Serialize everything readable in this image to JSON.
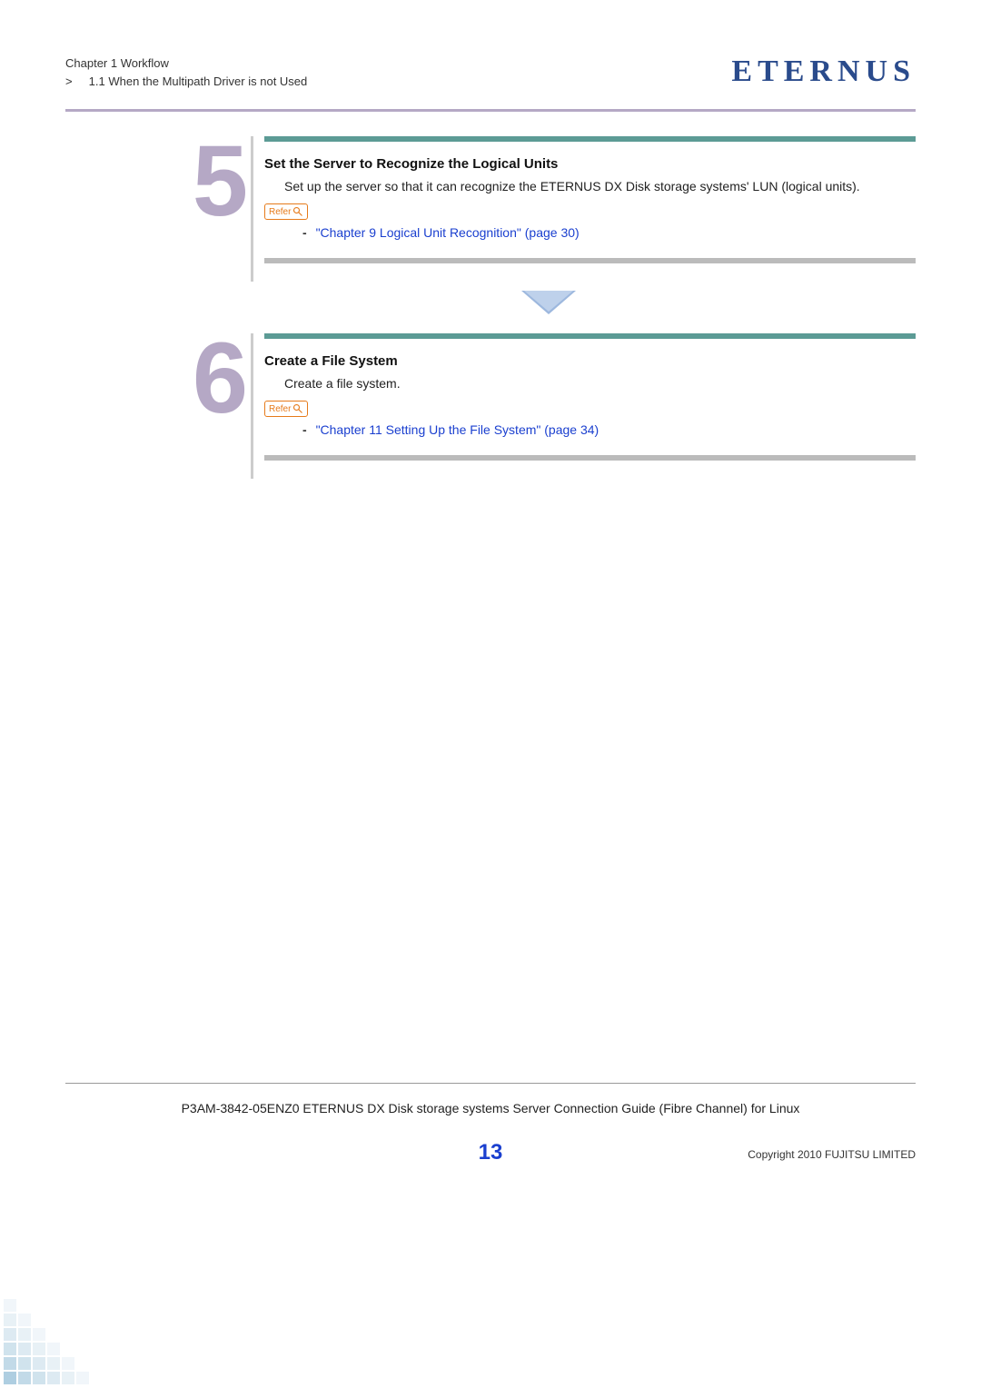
{
  "header": {
    "chapter": "Chapter 1  Workflow",
    "section_prefix": ">",
    "section": "1.1  When the Multipath Driver is not Used",
    "brand": "ETERNUS"
  },
  "steps": [
    {
      "num": "5",
      "title": "Set the Server to Recognize the Logical Units",
      "desc": "Set up the server so that it can recognize the ETERNUS DX Disk storage systems' LUN (logical units).",
      "refer_label": "Refer",
      "ref_link": "\"Chapter 9 Logical Unit Recognition\" (page 30)"
    },
    {
      "num": "6",
      "title": "Create a File System",
      "desc": "Create a file system.",
      "refer_label": "Refer",
      "ref_link": "\"Chapter 11 Setting Up the File System\" (page 34)"
    }
  ],
  "footer": {
    "doc_line": "P3AM-3842-05ENZ0  ETERNUS DX Disk storage systems Server Connection Guide (Fibre Channel) for Linux",
    "page_number": "13",
    "copyright": "Copyright 2010 FUJITSU LIMITED"
  }
}
